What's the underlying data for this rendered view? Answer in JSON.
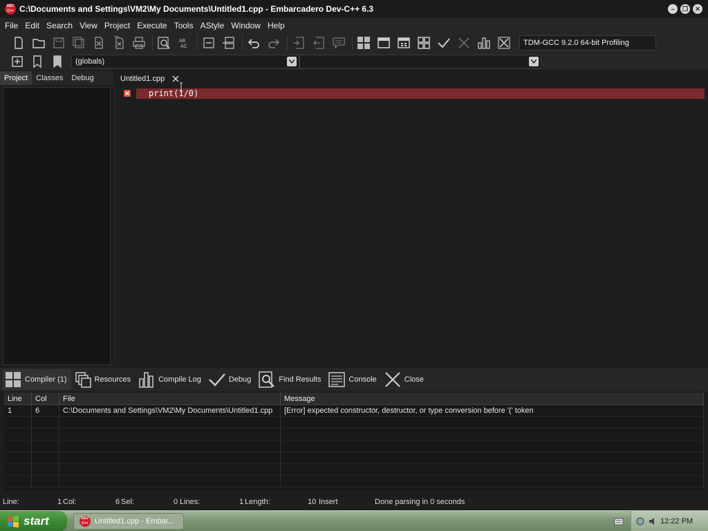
{
  "window": {
    "title": "C:\\Documents and Settings\\VM2\\My Documents\\Untitled1.cpp - Embarcadero Dev-C++ 6.3",
    "icon_text": "DEV C++"
  },
  "menu": [
    "File",
    "Edit",
    "Search",
    "View",
    "Project",
    "Execute",
    "Tools",
    "AStyle",
    "Window",
    "Help"
  ],
  "toolbar": {
    "compiler": "TDM-GCC 9.2.0 64-bit Profiling",
    "scope_combo": "(globals)",
    "icons": [
      "new-file-icon",
      "open-file-icon",
      "save-icon",
      "save-all-icon",
      "close-file-icon",
      "close-all-icon",
      "print-icon",
      "find-icon",
      "replace-icon",
      "goto-line-icon",
      "split-icon",
      "undo-icon",
      "redo-icon",
      "indent-icon",
      "unindent-icon",
      "comment-icon",
      "grid-icon",
      "window-icon",
      "layout-icon",
      "tiles-icon",
      "check-icon",
      "stop-icon",
      "chart-icon",
      "close-x-icon"
    ]
  },
  "left_tabs": [
    "Project",
    "Classes",
    "Debug"
  ],
  "editor": {
    "tab_label": "Untitled1.cpp",
    "code": "print(1/0)"
  },
  "bottom_tabs": [
    {
      "label": "Compiler (1)",
      "icon": "compiler-icon"
    },
    {
      "label": "Resources",
      "icon": "resources-icon"
    },
    {
      "label": "Compile Log",
      "icon": "compile-log-icon"
    },
    {
      "label": "Debug",
      "icon": "debug-icon"
    },
    {
      "label": "Find Results",
      "icon": "find-results-icon"
    },
    {
      "label": "Console",
      "icon": "console-icon"
    },
    {
      "label": "Close",
      "icon": "close-icon"
    }
  ],
  "messages": {
    "headers": {
      "line": "Line",
      "col": "Col",
      "file": "File",
      "message": "Message"
    },
    "rows": [
      {
        "line": "1",
        "col": "6",
        "file": "C:\\Documents and Settings\\VM2\\My Documents\\Untitled1.cpp",
        "message": "[Error] expected constructor, destructor, or type conversion before '(' token"
      }
    ]
  },
  "status": {
    "line_label": "Line:",
    "line": "1",
    "col_label": "Col:",
    "col": "6",
    "sel_label": "Sel:",
    "sel": "0",
    "lines_label": "Lines:",
    "lines": "1",
    "length_label": "Length:",
    "length": "10",
    "mode": "Insert",
    "parse": "Done parsing in 0 seconds"
  },
  "taskbar": {
    "start": "start",
    "task": "Untitled1.cpp - Embar...",
    "clock": "12:22 PM"
  },
  "colors": {
    "error_line": "#7a2a2f",
    "background": "#1e1e1e"
  }
}
